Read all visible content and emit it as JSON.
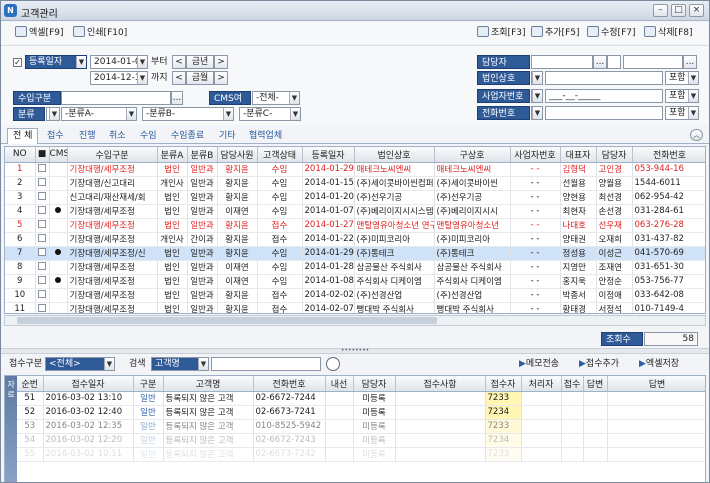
{
  "window": {
    "title": "고객관리"
  },
  "toolbar": {
    "excel": "엑셀[F9]",
    "print": "인쇄[F10]",
    "search": "조회[F3]",
    "add": "추가[F5]",
    "edit": "수정[F7]",
    "delete": "삭제[F8]"
  },
  "filters": {
    "date_field": "등록일자",
    "date_from": "2014-01-01",
    "date_to": "2014-12-31",
    "from_suffix": "부터",
    "to_suffix": "까지",
    "this_year": "금년",
    "this_month": "금월",
    "prev": "<",
    "next": ">",
    "ellipsis": "...",
    "receipt_type_label": "수입구분",
    "cms_label": "CMS여부",
    "cms_value": "-전체-",
    "class_label": "분류",
    "class_a": "-분류A-",
    "class_b": "-분류B-",
    "class_c": "-분류C-",
    "manager_label": "담당자",
    "company_label": "법인상호",
    "bizno_label": "사업자번호",
    "bizno_value": "___-__-_____",
    "phone_label": "전화번호",
    "contains": "포함"
  },
  "tabs": [
    "전 체",
    "접수",
    "진행",
    "취소",
    "수임",
    "수임종료",
    "기타",
    "협력업체"
  ],
  "grid1": {
    "headers": [
      "NO",
      "■",
      "CMS",
      "수입구분",
      "분류A",
      "분류B",
      "담당사원",
      "고객상태",
      "등록일자",
      "법인상호",
      "구상호",
      "사업자번호",
      "대표자",
      "담당자",
      "전화번호"
    ],
    "rows": [
      {
        "no": "1",
        "cms": "",
        "type": "기장대행/세무조정",
        "a": "법인",
        "b": "일반과",
        "staff": "황지윤",
        "status": "수임",
        "date": "2014-01-29",
        "corp": "매테크노씨엔씨",
        "old": "매테크노씨엔씨",
        "bizno": "- -",
        "ceo": "김형덕",
        "mgr": "고인경",
        "tel": "053-944-16",
        "style": "red"
      },
      {
        "no": "2",
        "cms": "",
        "type": "기장대행/신고대리",
        "a": "개인사",
        "b": "일반과",
        "staff": "황지윤",
        "status": "수임",
        "date": "2014-01-15",
        "corp": "(주)세이콧바이씬컴퍼",
        "old": "(주)세이콧바이씬",
        "bizno": "- -",
        "ceo": "선월용",
        "mgr": "양월용",
        "tel": "1544-6011",
        "style": ""
      },
      {
        "no": "3",
        "cms": "",
        "type": "신고대리/재산재세/회",
        "a": "법인",
        "b": "일반과",
        "staff": "황지윤",
        "status": "수임",
        "date": "2014-01-20",
        "corp": "(주)선우기공",
        "old": "(주)선우기공",
        "bizno": "- -",
        "ceo": "양현용",
        "mgr": "최선경",
        "tel": "062-954-42",
        "style": ""
      },
      {
        "no": "4",
        "cms": "●",
        "type": "기장대행/세무조정",
        "a": "법인",
        "b": "일반과",
        "staff": "이재연",
        "status": "수임",
        "date": "2014-01-07",
        "corp": "(주)베리이지시시스템",
        "old": "(주)베리이지시시",
        "bizno": "- -",
        "ceo": "최현자",
        "mgr": "손선경",
        "tel": "031-284-61",
        "style": ""
      },
      {
        "no": "5",
        "cms": "",
        "type": "기장대행/세무조정",
        "a": "법인",
        "b": "일반과",
        "staff": "황지윤",
        "status": "접수",
        "date": "2014-01-27",
        "corp": "맨탈영유아청소년 연구",
        "old": "맨탈영유아청소년",
        "bizno": "- -",
        "ceo": "나대호",
        "mgr": "선우재",
        "tel": "063-276-28",
        "style": "red"
      },
      {
        "no": "6",
        "cms": "",
        "type": "기장대행/세무조정",
        "a": "개인사",
        "b": "간이과",
        "staff": "황지윤",
        "status": "접수",
        "date": "2014-01-22",
        "corp": "(주)미피코리아",
        "old": "(주)미피코리아",
        "bizno": "- -",
        "ceo": "양태권",
        "mgr": "오재희",
        "tel": "031-437-82",
        "style": ""
      },
      {
        "no": "7",
        "cms": "●",
        "type": "기장대행/세무조정/신",
        "a": "법인",
        "b": "일반과",
        "staff": "황지윤",
        "status": "수임",
        "date": "2014-01-29",
        "corp": "(주)통테크",
        "old": "(주)통테크",
        "bizno": "- -",
        "ceo": "정성용",
        "mgr": "이성근",
        "tel": "041-570-69",
        "style": "sel"
      },
      {
        "no": "8",
        "cms": "",
        "type": "기장대행/세무조정",
        "a": "법인",
        "b": "일반과",
        "staff": "이재연",
        "status": "수임",
        "date": "2014-01-28",
        "corp": "삼공물산 주식회사",
        "old": "삼공물산 주식회사",
        "bizno": "- -",
        "ceo": "지영만",
        "mgr": "조재연",
        "tel": "031-651-30",
        "style": ""
      },
      {
        "no": "9",
        "cms": "●",
        "type": "기장대행/세무조정",
        "a": "법인",
        "b": "일반과",
        "staff": "이재연",
        "status": "수임",
        "date": "2014-01-08",
        "corp": "주식회사 디케이엠",
        "old": "주식회사 디케이엠",
        "bizno": "- -",
        "ceo": "홍지욱",
        "mgr": "안정순",
        "tel": "053-756-77",
        "style": ""
      },
      {
        "no": "10",
        "cms": "",
        "type": "기장대행/세무조정",
        "a": "법인",
        "b": "일반과",
        "staff": "황지윤",
        "status": "접수",
        "date": "2014-02-02",
        "corp": "(주)선경산업",
        "old": "(주)선경산업",
        "bizno": "- -",
        "ceo": "박종서",
        "mgr": "이정애",
        "tel": "033-642-08",
        "style": ""
      },
      {
        "no": "11",
        "cms": "",
        "type": "기장대행/세무조정",
        "a": "법인",
        "b": "일반과",
        "staff": "황지윤",
        "status": "접수",
        "date": "2014-02-07",
        "corp": "뻥대박 주식회사",
        "old": "뻥대박 주식회사",
        "bizno": "- -",
        "ceo": "황태경",
        "mgr": "서정석",
        "tel": "010-7149-4",
        "style": ""
      }
    ]
  },
  "total": {
    "label": "조회수",
    "value": "58"
  },
  "bottom": {
    "receipt_label": "접수구분",
    "receipt_value": "<전체>",
    "search_label": "검색",
    "search_field": "고객명",
    "memo_btn": "메모전송",
    "add_btn": "접수추가",
    "excel_btn": "엑셀저장"
  },
  "grid2": {
    "side_label": "자료",
    "headers": [
      "순번",
      "접수일자",
      "구분",
      "고객명",
      "전화번호",
      "내선",
      "담당자",
      "접수사항",
      "접수자",
      "처리자",
      "접수",
      "답변",
      "답변"
    ],
    "rows": [
      {
        "seq": "51",
        "date": "2016-03-02 13:10",
        "kind": "일반",
        "name": "등록되지 않은 고객",
        "tel": "02-6672-7244",
        "ext": "",
        "mgr": "미등록",
        "item": "",
        "recv": "7233",
        "fade": ""
      },
      {
        "seq": "52",
        "date": "2016-03-02 12:40",
        "kind": "일반",
        "name": "등록되지 않은 고객",
        "tel": "02-6673-7241",
        "ext": "",
        "mgr": "미등록",
        "item": "",
        "recv": "7234",
        "fade": ""
      },
      {
        "seq": "53",
        "date": "2016-03-02 12:35",
        "kind": "일반",
        "name": "등록되지 않은 고객",
        "tel": "010-8525-5942",
        "ext": "",
        "mgr": "미등록",
        "item": "",
        "recv": "7233",
        "fade": "fade1"
      },
      {
        "seq": "54",
        "date": "2016-03-02 12:20",
        "kind": "일반",
        "name": "등록되지 않은 고객",
        "tel": "02-6672-7243",
        "ext": "",
        "mgr": "미등록",
        "item": "",
        "recv": "7234",
        "fade": "fade2"
      },
      {
        "seq": "55",
        "date": "2016-03-02 10:11",
        "kind": "일반",
        "name": "등록되지 않은 고객",
        "tel": "02-6673-7242",
        "ext": "",
        "mgr": "미등록",
        "item": "",
        "recv": "7233",
        "fade": "fade3"
      }
    ]
  }
}
